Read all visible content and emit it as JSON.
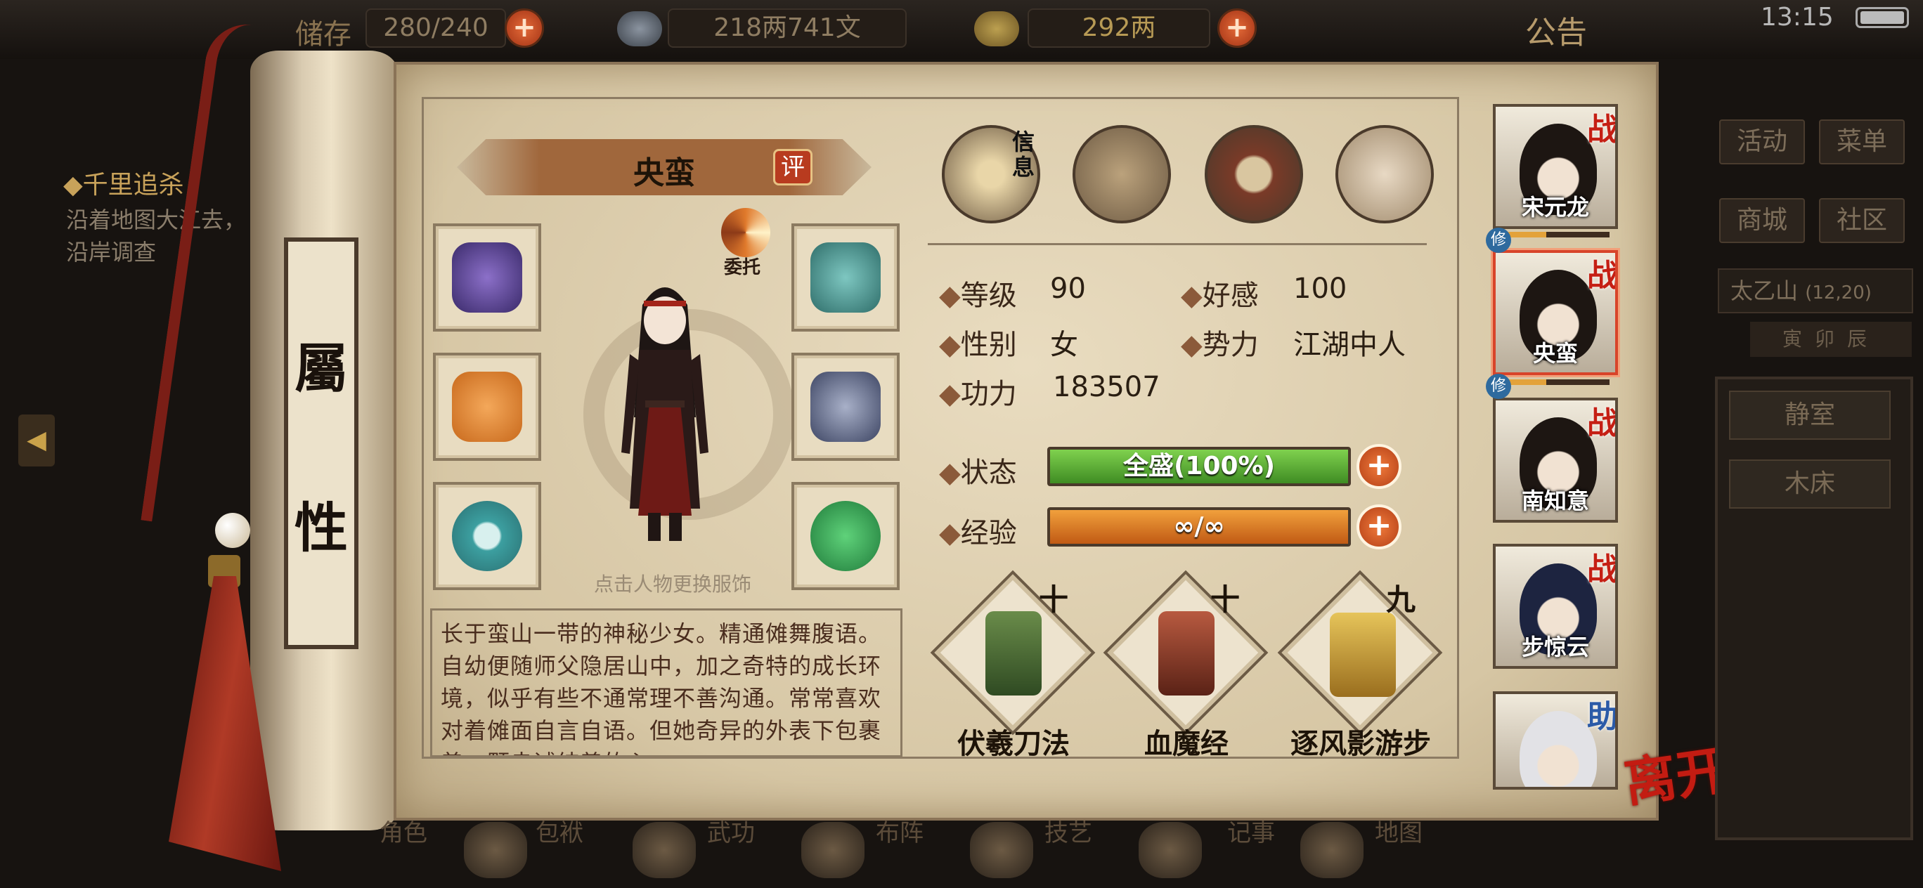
{
  "topbar": {
    "resource1_label": "储存",
    "resource1_value": "280/240",
    "silver_value": "218两741文",
    "gold_value": "292两",
    "plus": "+",
    "notice": "公告",
    "time": "13:15"
  },
  "quest": {
    "title": "◆千里追杀",
    "desc": "沿着地图大江去，沿岸调查"
  },
  "scroll_label": [
    "屬",
    "性"
  ],
  "character": {
    "name": "央蛮",
    "review_badge": "评",
    "delegate_label": "委托",
    "change_outfit_hint": "点击人物更换服饰",
    "bio": "长于蛮山一带的神秘少女。精通傩舞腹语。自幼便随师父隐居山中，加之奇特的成长环境，似乎有些不通常理不善沟通。常常喜欢对着傩面自言自语。但她奇异的外表下包裹着一颗赤诚纯善的心"
  },
  "tabs": {
    "info_label": "信息",
    "icons": [
      "info-portrait-icon",
      "scroll-tab-icon",
      "bagua-tab-icon",
      "muscle-tab-icon"
    ]
  },
  "stats": {
    "level_label": "等级",
    "level_value": "90",
    "affinity_label": "好感",
    "affinity_value": "100",
    "gender_label": "性别",
    "gender_value": "女",
    "faction_label": "势力",
    "faction_value": "江湖中人",
    "power_label": "功力",
    "power_value": "183507",
    "status_label": "状态",
    "status_value": "全盛(100%)",
    "status_fill": 1.0,
    "exp_label": "经验",
    "exp_value": "∞/∞",
    "exp_fill": 1.0,
    "diamond": "◆"
  },
  "skills": [
    {
      "name": "伏羲刀法",
      "level": "十",
      "color": "#4d7a3a"
    },
    {
      "name": "血魔经",
      "level": "十",
      "color": "#8c3a28"
    },
    {
      "name": "逐风影游步",
      "level": "九",
      "color": "#c9a23a"
    }
  ],
  "party": [
    {
      "name": "宋元龙",
      "tag": "战",
      "train": "修"
    },
    {
      "name": "央蛮",
      "tag": "战",
      "train": "修"
    },
    {
      "name": "南知意",
      "tag": "战",
      "train": ""
    },
    {
      "name": "步惊云",
      "tag": "战",
      "train": ""
    },
    {
      "name": "",
      "tag": "助",
      "train": ""
    }
  ],
  "leave_label": "离开",
  "right_panel": {
    "activity": "活动",
    "menu": "菜单",
    "shop": "商城",
    "community": "社区",
    "location": "太乙山",
    "coords": "(12,20)",
    "time_of_day": "寅卯辰",
    "quiet_room": "静室",
    "wood_bed": "木床"
  },
  "bottom_nav": [
    "角色",
    "包袱",
    "武功",
    "布阵",
    "技艺",
    "记事",
    "地图"
  ],
  "colors": {
    "paper": "#e3d5b7",
    "accent_red": "#c31c12",
    "status_green": "#5fae38",
    "exp_orange": "#e07f28"
  }
}
